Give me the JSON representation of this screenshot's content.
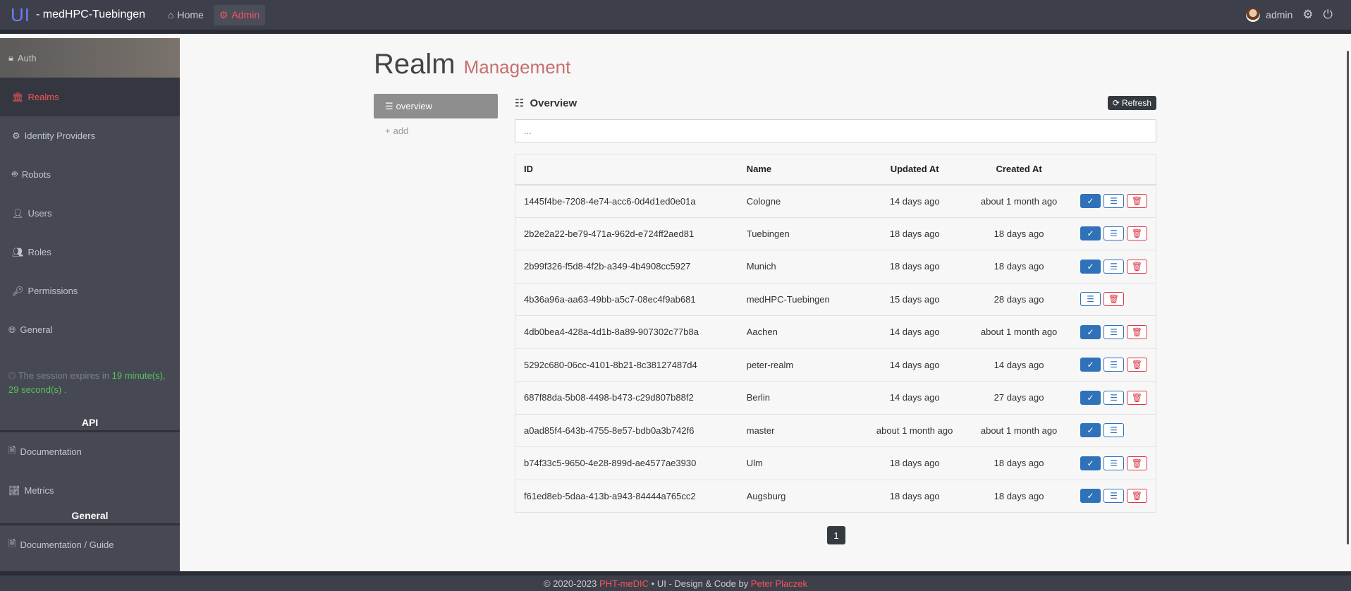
{
  "brand": {
    "logo": "UI",
    "title": "- medHPC-Tuebingen"
  },
  "topnav": {
    "home": "Home",
    "admin": "Admin"
  },
  "user": {
    "name": "admin"
  },
  "sidebar": {
    "head": "Auth",
    "items": [
      {
        "label": "Realms",
        "icon": "bank-icon"
      },
      {
        "label": "Identity Providers",
        "icon": "gear-icon"
      },
      {
        "label": "Robots",
        "icon": "robot-icon"
      },
      {
        "label": "Users",
        "icon": "user-icon"
      },
      {
        "label": "Roles",
        "icon": "users-icon"
      },
      {
        "label": "Permissions",
        "icon": "key-icon"
      }
    ],
    "general": "General",
    "session": {
      "prefix": "The session expires in",
      "minutes": "19",
      "rest": "minute(s), 29 second(s)",
      "suffix": "."
    },
    "api_section": "API",
    "api_items": [
      {
        "label": "Documentation"
      },
      {
        "label": "Metrics"
      }
    ],
    "general_section": "General",
    "general_items": [
      {
        "label": "Documentation / Guide"
      }
    ]
  },
  "page": {
    "title": "Realm",
    "subtitle": "Management"
  },
  "left_menu": {
    "overview": "overview",
    "add": "add"
  },
  "overview": {
    "title": "Overview",
    "refresh": "Refresh",
    "search_placeholder": "...",
    "columns": [
      "ID",
      "Name",
      "Updated At",
      "Created At"
    ],
    "rows": [
      {
        "id": "1445f4be-7208-4e74-acc6-0d4d1ed0e01a",
        "name": "Cologne",
        "updated": "14 days ago",
        "created": "about 1 month ago",
        "buttons": [
          "ok",
          "edit",
          "del"
        ]
      },
      {
        "id": "2b2e2a22-be79-471a-962d-e724ff2aed81",
        "name": "Tuebingen",
        "updated": "18 days ago",
        "created": "18 days ago",
        "buttons": [
          "ok",
          "edit",
          "del"
        ]
      },
      {
        "id": "2b99f326-f5d8-4f2b-a349-4b4908cc5927",
        "name": "Munich",
        "updated": "18 days ago",
        "created": "18 days ago",
        "buttons": [
          "ok",
          "edit",
          "del"
        ]
      },
      {
        "id": "4b36a96a-aa63-49bb-a5c7-08ec4f9ab681",
        "name": "medHPC-Tuebingen",
        "updated": "15 days ago",
        "created": "28 days ago",
        "buttons": [
          "edit",
          "del"
        ]
      },
      {
        "id": "4db0bea4-428a-4d1b-8a89-907302c77b8a",
        "name": "Aachen",
        "updated": "14 days ago",
        "created": "about 1 month ago",
        "buttons": [
          "ok",
          "edit",
          "del"
        ]
      },
      {
        "id": "5292c680-06cc-4101-8b21-8c38127487d4",
        "name": "peter-realm",
        "updated": "14 days ago",
        "created": "14 days ago",
        "buttons": [
          "ok",
          "edit",
          "del"
        ]
      },
      {
        "id": "687f88da-5b08-4498-b473-c29d807b88f2",
        "name": "Berlin",
        "updated": "14 days ago",
        "created": "27 days ago",
        "buttons": [
          "ok",
          "edit",
          "del"
        ]
      },
      {
        "id": "a0ad85f4-643b-4755-8e57-bdb0a3b742f6",
        "name": "master",
        "updated": "about 1 month ago",
        "created": "about 1 month ago",
        "buttons": [
          "ok",
          "edit"
        ]
      },
      {
        "id": "b74f33c5-9650-4e28-899d-ae4577ae3930",
        "name": "Ulm",
        "updated": "18 days ago",
        "created": "18 days ago",
        "buttons": [
          "ok",
          "edit",
          "del"
        ]
      },
      {
        "id": "f61ed8eb-5daa-413b-a943-84444a765cc2",
        "name": "Augsburg",
        "updated": "18 days ago",
        "created": "18 days ago",
        "buttons": [
          "ok",
          "edit",
          "del"
        ]
      }
    ]
  },
  "pagination": {
    "current": "1"
  },
  "footer": {
    "copy": "© 2020-2023",
    "org": "PHT-meDIC",
    "middle": "• UI - Design & Code by",
    "author": "Peter Placzek"
  },
  "colors": {
    "accent": "#f2545b",
    "primary": "#2f72b9",
    "danger": "#dc3545",
    "navbar": "#3d404a",
    "sidebar": "#464953"
  }
}
